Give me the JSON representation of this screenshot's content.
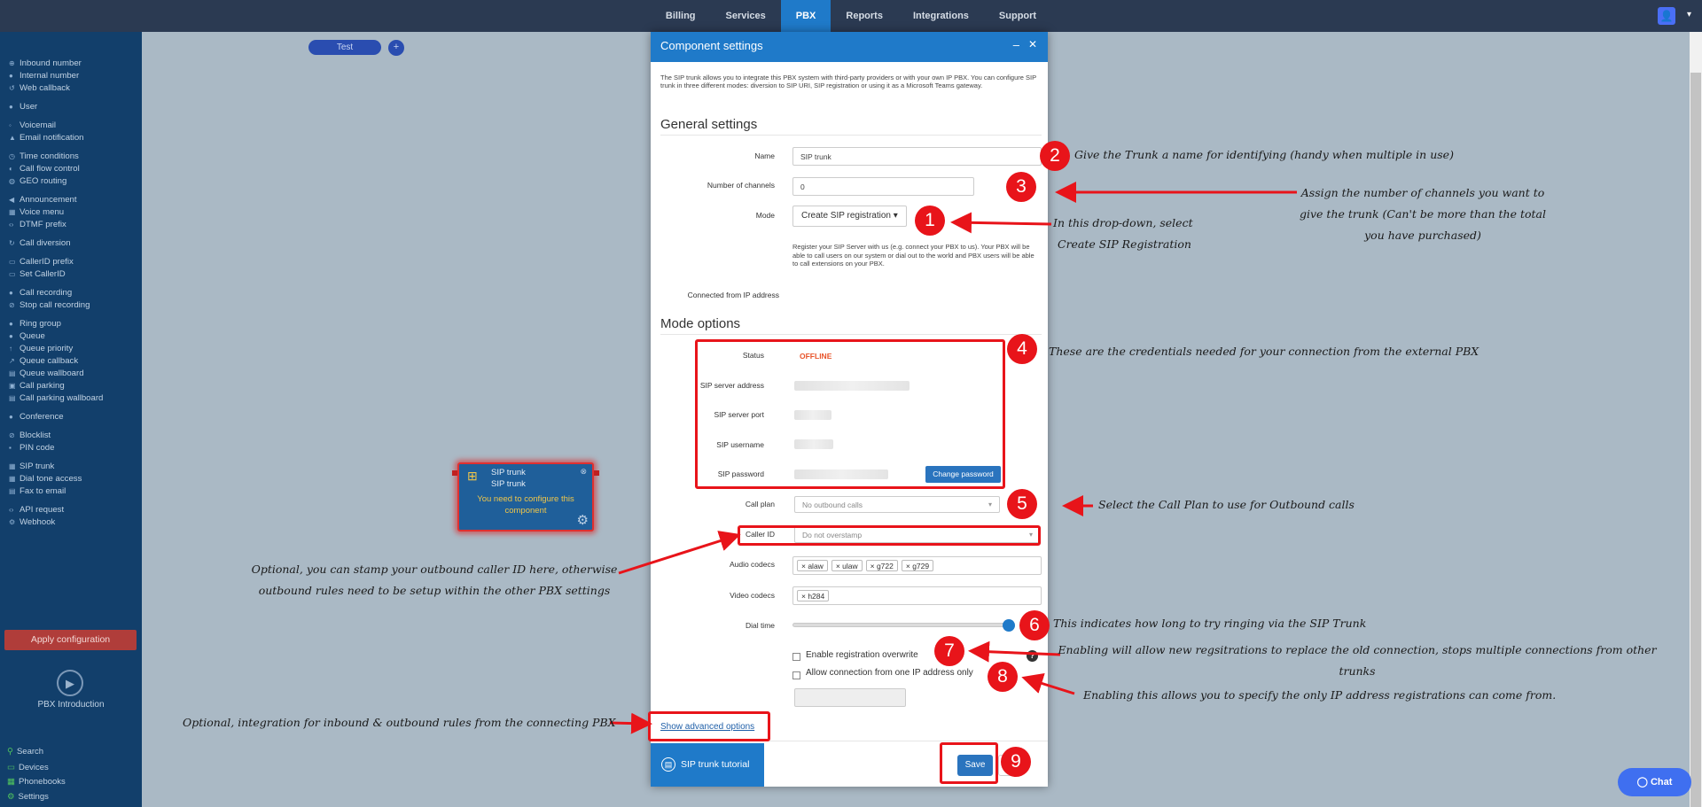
{
  "topnav": {
    "items": [
      "Billing",
      "Services",
      "PBX",
      "Reports",
      "Integrations",
      "Support"
    ],
    "active": "PBX"
  },
  "sidebar": {
    "items": [
      "Inbound number",
      "Internal number",
      "Web callback",
      "User",
      "Voicemail",
      "Email notification",
      "Time conditions",
      "Call flow control",
      "GEO routing",
      "Announcement",
      "Voice menu",
      "DTMF prefix",
      "Call diversion",
      "CallerID prefix",
      "Set CallerID",
      "Call recording",
      "Stop call recording",
      "Ring group",
      "Queue",
      "Queue priority",
      "Queue callback",
      "Queue wallboard",
      "Call parking",
      "Call parking wallboard",
      "Conference",
      "Blocklist",
      "PIN code",
      "SIP trunk",
      "Dial tone access",
      "Fax to email",
      "API request",
      "Webhook"
    ],
    "apply": "Apply configuration",
    "intro": "PBX Introduction",
    "bottom": [
      "Search",
      "Devices",
      "Phonebooks",
      "Settings"
    ]
  },
  "canvas": {
    "test_label": "Test",
    "plus_label": "+",
    "node": {
      "title1": "SIP trunk",
      "title2": "SIP trunk",
      "msg": "You need to configure this component"
    }
  },
  "chat_label": "Chat",
  "modal": {
    "title": "Component settings",
    "description": "The SIP trunk allows you to integrate this PBX system with third-party providers or with your own IP PBX. You can configure SIP trunk in three different modes: diversion to SIP URI, SIP registration or using it as a Microsoft Teams gateway.",
    "general_title": "General settings",
    "name_label": "Name",
    "name_value": "SIP trunk",
    "channels_label": "Number of channels",
    "channels_value": "0",
    "mode_label": "Mode",
    "mode_value": "Create SIP registration ▾",
    "mode_help": "Register your SIP Server with us (e.g. connect your PBX to us). Your PBX will be able to call users on our system or dial out to the world and PBX users will be able to call extensions on your PBX.",
    "connected_label": "Connected from IP address",
    "mode_options_title": "Mode options",
    "status_label": "Status",
    "status_value": "OFFLINE",
    "server_address_label": "SIP server address",
    "server_port_label": "SIP server port",
    "username_label": "SIP username",
    "password_label": "SIP password",
    "change_password": "Change password",
    "call_plan_label": "Call plan",
    "call_plan_value": "No outbound calls",
    "caller_id_label": "Caller ID",
    "caller_id_value": "Do not overstamp",
    "audio_codecs_label": "Audio codecs",
    "audio_codecs": [
      "× alaw",
      "× ulaw",
      "× g722",
      "× g729"
    ],
    "video_codecs_label": "Video codecs",
    "video_codecs": [
      "× h284"
    ],
    "dial_time_label": "Dial time",
    "dial_time_fraction": 1.0,
    "registration_overwrite": "Enable registration overwrite",
    "one_ip_only": "Allow connection from one IP address only",
    "advanced_link": "Show advanced options",
    "tutorial": "SIP trunk tutorial",
    "save": "Save"
  },
  "annotations": {
    "n1": "1",
    "n2": "2",
    "n3": "3",
    "n4": "4",
    "n5": "5",
    "n6": "6",
    "n7": "7",
    "n8": "8",
    "n9": "9",
    "a2": "Give the Trunk a name for identifying (handy when multiple in use)",
    "a3_1": "Assign the number of channels you want to",
    "a3_2": "give the trunk (Can't be more than the total",
    "a3_3": "you have purchased)",
    "a1_1": "In this drop-down, select",
    "a1_2": "Create SIP Registration",
    "a4": "These are the credentials needed for your connection from the external PBX",
    "a5": "Select the Call Plan to use for Outbound calls",
    "a_caller_1": "Optional, you can stamp your outbound caller ID here, otherwise",
    "a_caller_2": "outbound rules need to be setup within the other PBX settings",
    "a6": "This indicates how long to try ringing via the SIP Trunk",
    "a7_1": "Enabling will allow new regsitrations to replace the old connection, stops multiple connections from other",
    "a7_2": "trunks",
    "a8": "Enabling this allows you to specify the only IP address registrations can come from.",
    "a_adv": "Optional, integration for inbound & outbound rules from the connecting PBX"
  }
}
